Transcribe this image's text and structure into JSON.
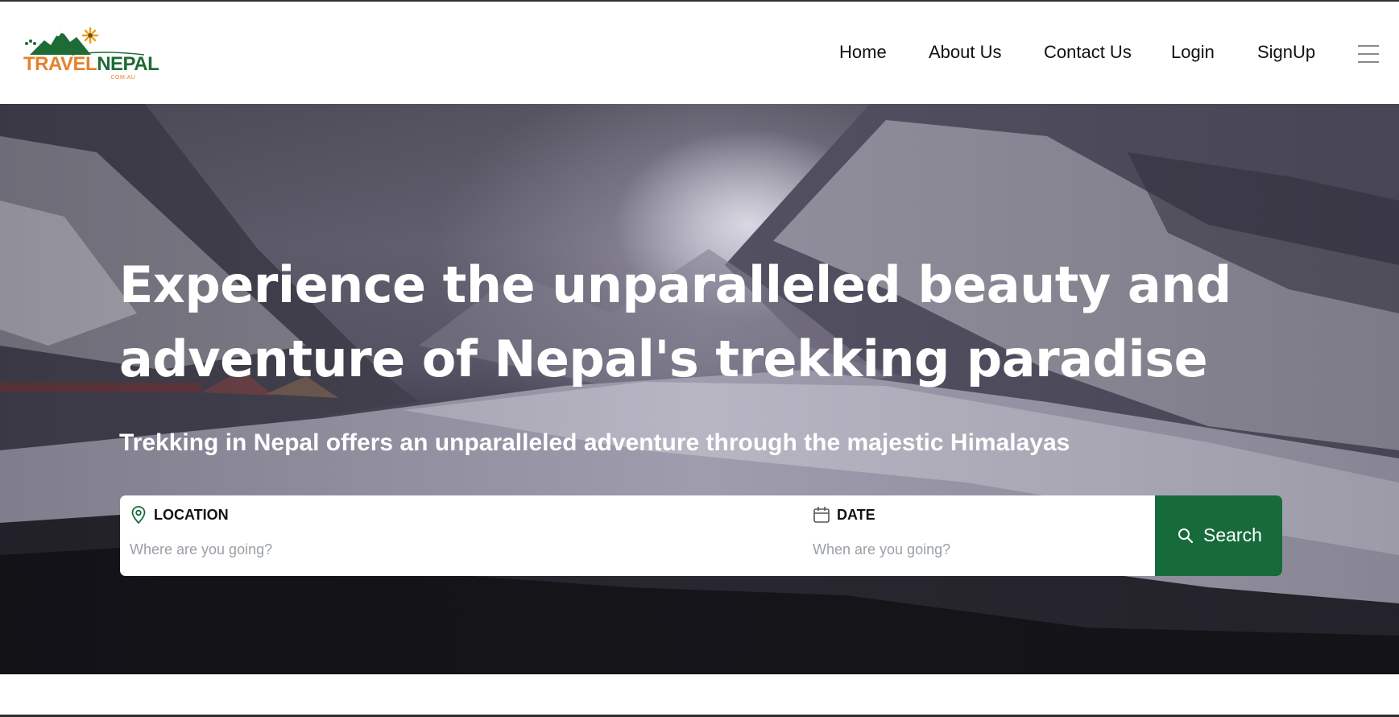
{
  "brand": {
    "logo_travel": "TRAVEL",
    "logo_nepal": "NEPAL",
    "logo_domain": ".COM.AU",
    "accent_orange": "#e6812b",
    "accent_green": "#1d6b35"
  },
  "nav": {
    "items": [
      {
        "label": "Home"
      },
      {
        "label": "About Us"
      },
      {
        "label": "Contact Us"
      },
      {
        "label": "Login"
      },
      {
        "label": "SignUp"
      }
    ],
    "menu_icon": "hamburger-menu-icon"
  },
  "hero": {
    "title": "Experience the unparalleled beauty and adventure of Nepal's trekking paradise",
    "subtitle": "Trekking in Nepal offers an unparalleled adventure through the majestic Himalayas"
  },
  "search": {
    "location": {
      "label": "LOCATION",
      "placeholder": "Where are you going?",
      "value": "",
      "icon": "map-pin-icon"
    },
    "date": {
      "label": "DATE",
      "placeholder": "When are you going?",
      "value": "",
      "icon": "calendar-icon"
    },
    "button_label": "Search",
    "button_icon": "search-icon",
    "button_color": "#176b3b"
  }
}
